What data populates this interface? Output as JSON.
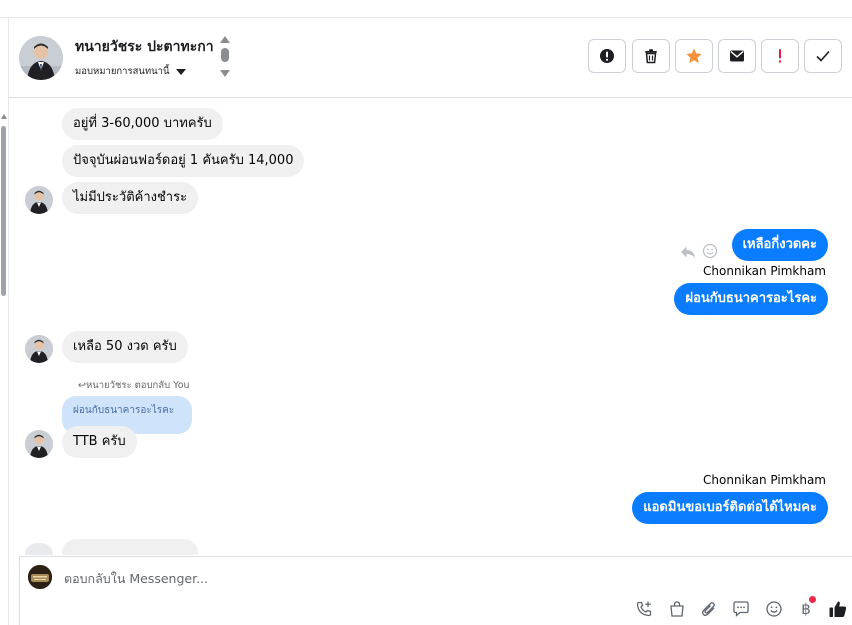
{
  "header": {
    "contact_name": "ทนายวัชระ ปะตาทะกา",
    "assign_label": "มอบหมายการสนทนานี้",
    "actions": [
      {
        "name": "spam",
        "icon": "alert-circle-icon",
        "color": "#1c1e21"
      },
      {
        "name": "delete",
        "icon": "trash-icon",
        "color": "#1c1e21"
      },
      {
        "name": "star",
        "icon": "star-icon",
        "color": "#f7923a"
      },
      {
        "name": "mark-unread",
        "icon": "envelope-icon",
        "color": "#1c1e21"
      },
      {
        "name": "follow-up",
        "icon": "exclamation-icon",
        "color": "#e41e3f"
      },
      {
        "name": "done",
        "icon": "check-icon",
        "color": "#1c1e21"
      }
    ]
  },
  "messages": {
    "m1": "อยู่ที่ 3-60,000 บาทครับ",
    "m2": "ปัจจุบันผ่อนฟอร์ดอยู่ 1 คันครับ 14,000",
    "m3": "ไม่มีประวัติค้างชำระ",
    "m4": "เหลือกี่งวดคะ",
    "m4_sender": "Chonnikan Pimkham",
    "m5": "ผ่อนกับธนาคารอะไรคะ",
    "m6": "เหลือ 50 งวด ครับ",
    "reply_hint": "หนายวัชระ ตอบกลับ You",
    "quoted": "ผ่อนกับธนาคารอะไรคะ",
    "m7": "TTB ครับ",
    "m8_sender": "Chonnikan Pimkham",
    "m8": "แอดมินขอเบอร์ติดต่อได้ไหมคะ"
  },
  "composer": {
    "placeholder": "ตอบกลับใน Messenger..."
  },
  "colors": {
    "outgoing_bubble": "#0a7cff",
    "incoming_bubble": "#f0f0f0",
    "quoted_bubble": "#cfe3fb",
    "like_icon": "#1c1e21",
    "notification_dot": "#f02849"
  }
}
